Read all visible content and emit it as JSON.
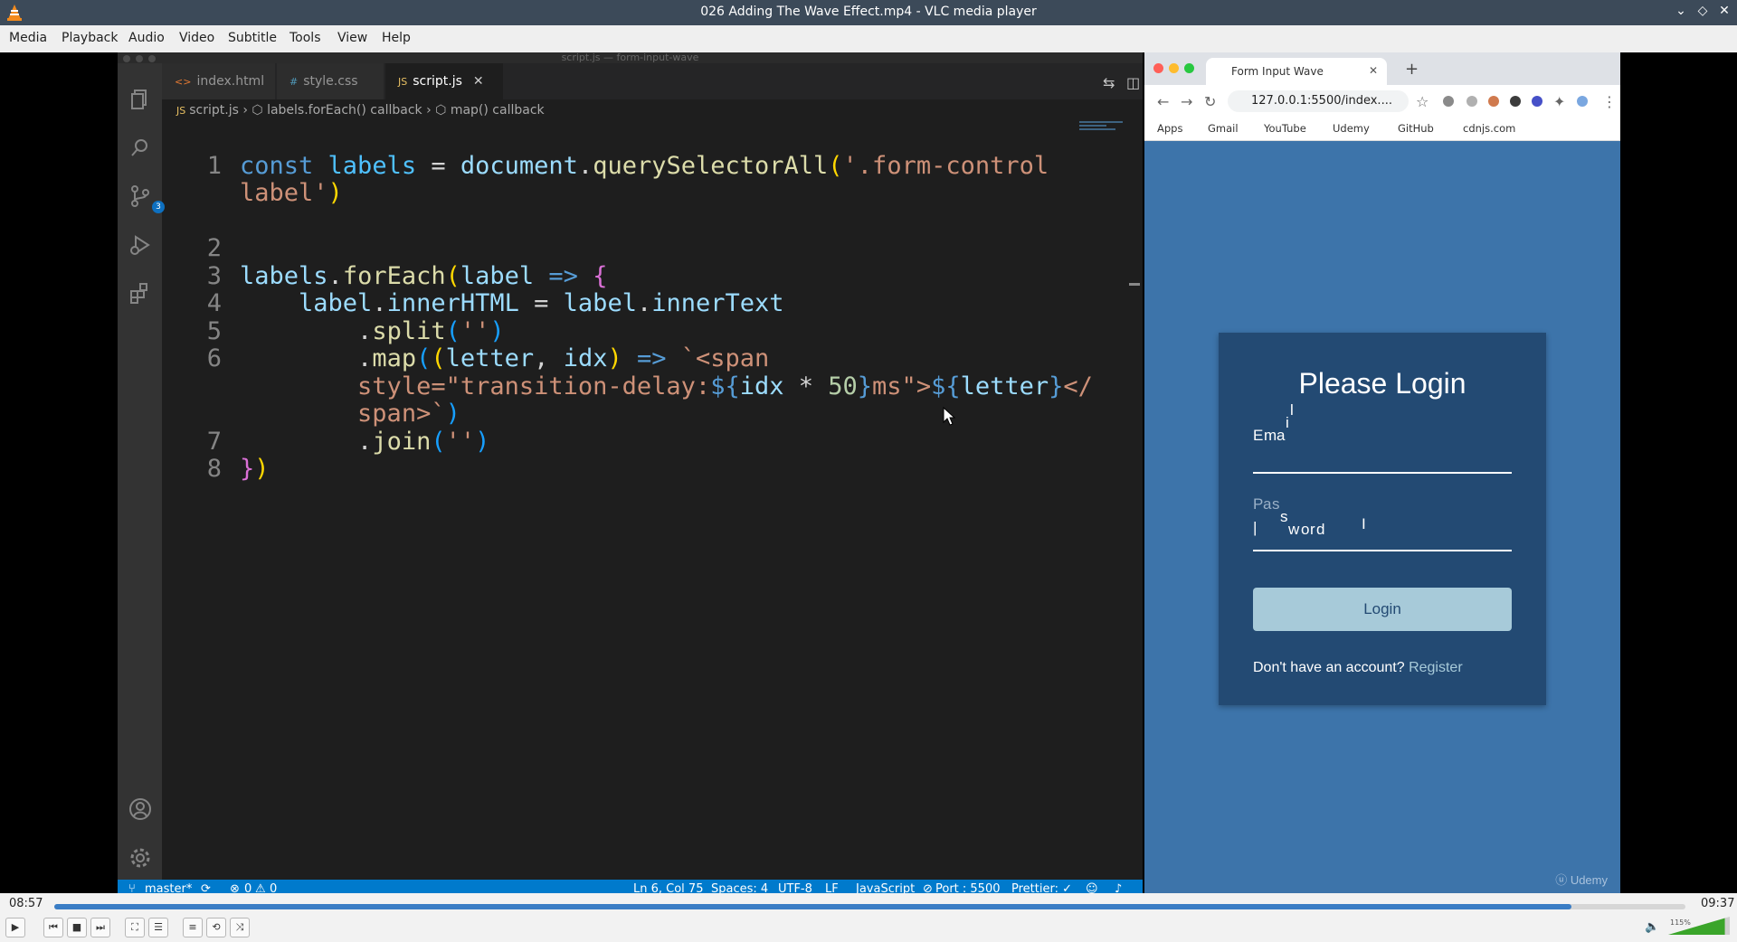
{
  "window": {
    "title": "026 Adding The Wave Effect.mp4 - VLC media player"
  },
  "menu": [
    "Media",
    "Playback",
    "Audio",
    "Video",
    "Subtitle",
    "Tools",
    "View",
    "Help"
  ],
  "vscode": {
    "window_title": "script.js — form-input-wave",
    "tabs": [
      {
        "ext": "<>",
        "label": "index.html"
      },
      {
        "ext": "#",
        "label": "style.css"
      },
      {
        "ext": "JS",
        "label": "script.js"
      }
    ],
    "breadcrumb": [
      "script.js",
      "labels.forEach() callback",
      "map() callback"
    ],
    "source_control_badge": "3",
    "line_numbers": [
      "1",
      "2",
      "3",
      "4",
      "5",
      "6",
      "7",
      "8"
    ],
    "status": {
      "branch": "master*",
      "problems": "0",
      "warnings": "0",
      "position": "Ln 6, Col 75",
      "spaces": "Spaces: 4",
      "encoding": "UTF-8",
      "eol": "LF",
      "language": "JavaScript",
      "port": "Port : 5500",
      "prettier": "Prettier: ✓"
    }
  },
  "browser": {
    "tab_title": "Form Input Wave",
    "url": "127.0.0.1:5500/index....",
    "bookmarks": [
      "Apps",
      "Gmail",
      "YouTube",
      "Udemy",
      "GitHub",
      "cdnjs.com"
    ],
    "card": {
      "title": "Please Login",
      "login_button": "Login",
      "register_prompt": "Don't have an account?",
      "register_link": "Register"
    },
    "watermark": "Udemy"
  },
  "player": {
    "elapsed": "08:57",
    "total": "09:37",
    "progress": 0.93,
    "volume_label": "115%",
    "volume": 1.15
  },
  "colors": {
    "accent": "#3a7dc5",
    "vscode_status": "#007acc",
    "page_bg": "#3d74aa",
    "card_bg": "#234a73",
    "button": "#a7cad9"
  }
}
